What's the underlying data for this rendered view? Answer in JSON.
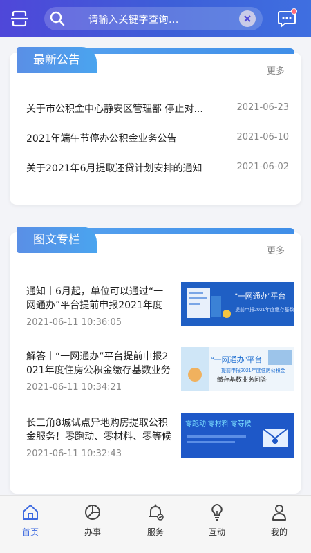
{
  "header": {
    "search_placeholder": "请输入关键字查询...",
    "accent": "#4f47d9"
  },
  "notices": {
    "title": "最新公告",
    "more": "更多",
    "items": [
      {
        "title": "关于市公积金中心静安区管理部 停止对...",
        "date": "2021-06-23"
      },
      {
        "title": "2021年端午节停办公积金业务公告",
        "date": "2021-06-10"
      },
      {
        "title": "关于2021年6月提取还贷计划安排的通知",
        "date": "2021-06-02"
      }
    ]
  },
  "articles": {
    "title": "图文专栏",
    "more": "更多",
    "items": [
      {
        "title": "通知丨6月起，单位可以通过“一网通办”平台提前申报2021年度住房公积金缴存基数",
        "time": "2021-06-11 10:36:05",
        "thumb": {
          "headline": "“一网通办”平台",
          "sub": "提前申报2021年度缴存基数"
        }
      },
      {
        "title": "解答丨“一网通办”平台提前申报2021年度住房公积金缴存基数业务问答",
        "time": "2021-06-11 10:34:21",
        "thumb": {
          "headline": "“一网通办”平台",
          "sub": "提前申报2021年度住房公积金",
          "sub2": "缴存基数业务问答"
        }
      },
      {
        "title": "长三角8城试点异地购房提取公积金服务！零跑动、零材料、零等候",
        "time": "2021-06-11 10:32:43",
        "thumb": {
          "headline": "零跑动 零材料 零等候"
        }
      }
    ]
  },
  "nav": [
    {
      "label": "首页",
      "icon": "home-icon",
      "active": true
    },
    {
      "label": "办事",
      "icon": "pie-chart-icon"
    },
    {
      "label": "服务",
      "icon": "bell-icon"
    },
    {
      "label": "互动",
      "icon": "lightbulb-icon"
    },
    {
      "label": "我的",
      "icon": "user-icon"
    }
  ]
}
